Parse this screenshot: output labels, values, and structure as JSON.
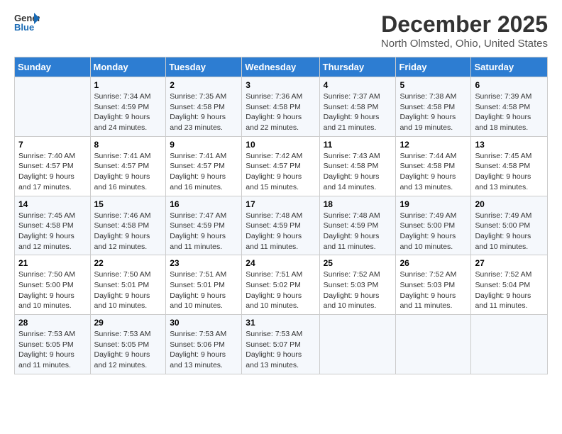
{
  "header": {
    "logo_line1": "General",
    "logo_line2": "Blue",
    "title": "December 2025",
    "subtitle": "North Olmsted, Ohio, United States"
  },
  "weekdays": [
    "Sunday",
    "Monday",
    "Tuesday",
    "Wednesday",
    "Thursday",
    "Friday",
    "Saturday"
  ],
  "weeks": [
    [
      {
        "day": "",
        "sunrise": "",
        "sunset": "",
        "daylight": ""
      },
      {
        "day": "1",
        "sunrise": "Sunrise: 7:34 AM",
        "sunset": "Sunset: 4:59 PM",
        "daylight": "Daylight: 9 hours and 24 minutes."
      },
      {
        "day": "2",
        "sunrise": "Sunrise: 7:35 AM",
        "sunset": "Sunset: 4:58 PM",
        "daylight": "Daylight: 9 hours and 23 minutes."
      },
      {
        "day": "3",
        "sunrise": "Sunrise: 7:36 AM",
        "sunset": "Sunset: 4:58 PM",
        "daylight": "Daylight: 9 hours and 22 minutes."
      },
      {
        "day": "4",
        "sunrise": "Sunrise: 7:37 AM",
        "sunset": "Sunset: 4:58 PM",
        "daylight": "Daylight: 9 hours and 21 minutes."
      },
      {
        "day": "5",
        "sunrise": "Sunrise: 7:38 AM",
        "sunset": "Sunset: 4:58 PM",
        "daylight": "Daylight: 9 hours and 19 minutes."
      },
      {
        "day": "6",
        "sunrise": "Sunrise: 7:39 AM",
        "sunset": "Sunset: 4:58 PM",
        "daylight": "Daylight: 9 hours and 18 minutes."
      }
    ],
    [
      {
        "day": "7",
        "sunrise": "Sunrise: 7:40 AM",
        "sunset": "Sunset: 4:57 PM",
        "daylight": "Daylight: 9 hours and 17 minutes."
      },
      {
        "day": "8",
        "sunrise": "Sunrise: 7:41 AM",
        "sunset": "Sunset: 4:57 PM",
        "daylight": "Daylight: 9 hours and 16 minutes."
      },
      {
        "day": "9",
        "sunrise": "Sunrise: 7:41 AM",
        "sunset": "Sunset: 4:57 PM",
        "daylight": "Daylight: 9 hours and 16 minutes."
      },
      {
        "day": "10",
        "sunrise": "Sunrise: 7:42 AM",
        "sunset": "Sunset: 4:57 PM",
        "daylight": "Daylight: 9 hours and 15 minutes."
      },
      {
        "day": "11",
        "sunrise": "Sunrise: 7:43 AM",
        "sunset": "Sunset: 4:58 PM",
        "daylight": "Daylight: 9 hours and 14 minutes."
      },
      {
        "day": "12",
        "sunrise": "Sunrise: 7:44 AM",
        "sunset": "Sunset: 4:58 PM",
        "daylight": "Daylight: 9 hours and 13 minutes."
      },
      {
        "day": "13",
        "sunrise": "Sunrise: 7:45 AM",
        "sunset": "Sunset: 4:58 PM",
        "daylight": "Daylight: 9 hours and 13 minutes."
      }
    ],
    [
      {
        "day": "14",
        "sunrise": "Sunrise: 7:45 AM",
        "sunset": "Sunset: 4:58 PM",
        "daylight": "Daylight: 9 hours and 12 minutes."
      },
      {
        "day": "15",
        "sunrise": "Sunrise: 7:46 AM",
        "sunset": "Sunset: 4:58 PM",
        "daylight": "Daylight: 9 hours and 12 minutes."
      },
      {
        "day": "16",
        "sunrise": "Sunrise: 7:47 AM",
        "sunset": "Sunset: 4:59 PM",
        "daylight": "Daylight: 9 hours and 11 minutes."
      },
      {
        "day": "17",
        "sunrise": "Sunrise: 7:48 AM",
        "sunset": "Sunset: 4:59 PM",
        "daylight": "Daylight: 9 hours and 11 minutes."
      },
      {
        "day": "18",
        "sunrise": "Sunrise: 7:48 AM",
        "sunset": "Sunset: 4:59 PM",
        "daylight": "Daylight: 9 hours and 11 minutes."
      },
      {
        "day": "19",
        "sunrise": "Sunrise: 7:49 AM",
        "sunset": "Sunset: 5:00 PM",
        "daylight": "Daylight: 9 hours and 10 minutes."
      },
      {
        "day": "20",
        "sunrise": "Sunrise: 7:49 AM",
        "sunset": "Sunset: 5:00 PM",
        "daylight": "Daylight: 9 hours and 10 minutes."
      }
    ],
    [
      {
        "day": "21",
        "sunrise": "Sunrise: 7:50 AM",
        "sunset": "Sunset: 5:00 PM",
        "daylight": "Daylight: 9 hours and 10 minutes."
      },
      {
        "day": "22",
        "sunrise": "Sunrise: 7:50 AM",
        "sunset": "Sunset: 5:01 PM",
        "daylight": "Daylight: 9 hours and 10 minutes."
      },
      {
        "day": "23",
        "sunrise": "Sunrise: 7:51 AM",
        "sunset": "Sunset: 5:01 PM",
        "daylight": "Daylight: 9 hours and 10 minutes."
      },
      {
        "day": "24",
        "sunrise": "Sunrise: 7:51 AM",
        "sunset": "Sunset: 5:02 PM",
        "daylight": "Daylight: 9 hours and 10 minutes."
      },
      {
        "day": "25",
        "sunrise": "Sunrise: 7:52 AM",
        "sunset": "Sunset: 5:03 PM",
        "daylight": "Daylight: 9 hours and 10 minutes."
      },
      {
        "day": "26",
        "sunrise": "Sunrise: 7:52 AM",
        "sunset": "Sunset: 5:03 PM",
        "daylight": "Daylight: 9 hours and 11 minutes."
      },
      {
        "day": "27",
        "sunrise": "Sunrise: 7:52 AM",
        "sunset": "Sunset: 5:04 PM",
        "daylight": "Daylight: 9 hours and 11 minutes."
      }
    ],
    [
      {
        "day": "28",
        "sunrise": "Sunrise: 7:53 AM",
        "sunset": "Sunset: 5:05 PM",
        "daylight": "Daylight: 9 hours and 11 minutes."
      },
      {
        "day": "29",
        "sunrise": "Sunrise: 7:53 AM",
        "sunset": "Sunset: 5:05 PM",
        "daylight": "Daylight: 9 hours and 12 minutes."
      },
      {
        "day": "30",
        "sunrise": "Sunrise: 7:53 AM",
        "sunset": "Sunset: 5:06 PM",
        "daylight": "Daylight: 9 hours and 13 minutes."
      },
      {
        "day": "31",
        "sunrise": "Sunrise: 7:53 AM",
        "sunset": "Sunset: 5:07 PM",
        "daylight": "Daylight: 9 hours and 13 minutes."
      },
      {
        "day": "",
        "sunrise": "",
        "sunset": "",
        "daylight": ""
      },
      {
        "day": "",
        "sunrise": "",
        "sunset": "",
        "daylight": ""
      },
      {
        "day": "",
        "sunrise": "",
        "sunset": "",
        "daylight": ""
      }
    ]
  ]
}
